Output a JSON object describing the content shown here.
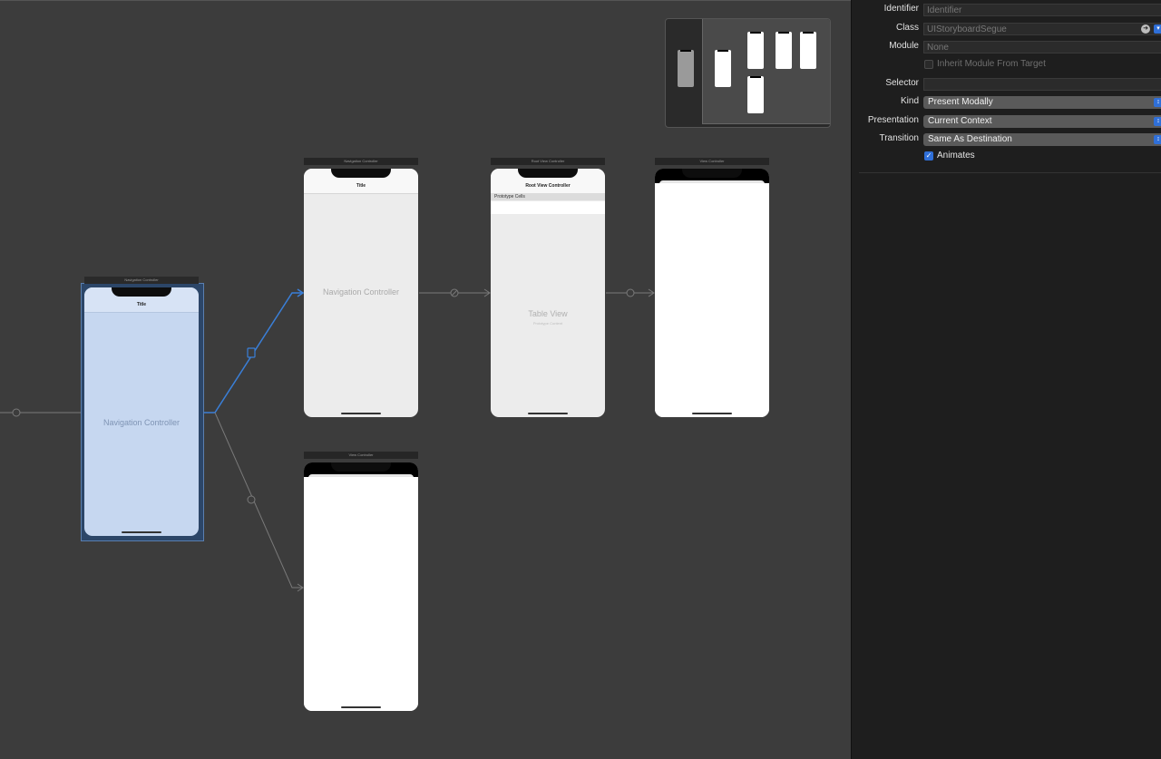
{
  "canvas": {
    "scenes": {
      "nav_main": {
        "bar": "Navigation Controller",
        "nav_title": "Title",
        "label": "Navigation Controller"
      },
      "nav_second": {
        "bar": "Navigation Controller",
        "nav_title": "Title",
        "label": "Navigation Controller"
      },
      "root_vc": {
        "bar": "Root View Controller",
        "nav_title": "Root View Controller",
        "prototype_cells": "Prototype Cells",
        "table_label": "Table View",
        "table_sub": "Prototype Content"
      },
      "vc_right": {
        "bar": "View Controller"
      },
      "vc_bottom": {
        "bar": "View Controller"
      }
    }
  },
  "inspector": {
    "identifier": {
      "label": "Identifier",
      "placeholder": "Identifier"
    },
    "class": {
      "label": "Class",
      "placeholder": "UIStoryboardSegue"
    },
    "module": {
      "label": "Module",
      "placeholder": "None"
    },
    "inherit_module": {
      "label": "Inherit Module From Target",
      "checked": false
    },
    "selector": {
      "label": "Selector",
      "value": ""
    },
    "kind": {
      "label": "Kind",
      "value": "Present Modally"
    },
    "presentation": {
      "label": "Presentation",
      "value": "Current Context"
    },
    "transition": {
      "label": "Transition",
      "value": "Same As Destination"
    },
    "animates": {
      "label": "Animates",
      "checked": true
    }
  },
  "colors": {
    "accent": "#2f6fd8",
    "selection_fill": "#c6d7f0",
    "canvas": "#3c3c3c",
    "inspector": "#1e1e1e"
  },
  "icons": {
    "go_arrow": "arrow-right-circle-icon",
    "popup_chevron": "chevron-updown-icon",
    "checkmark": "checkmark-icon"
  }
}
